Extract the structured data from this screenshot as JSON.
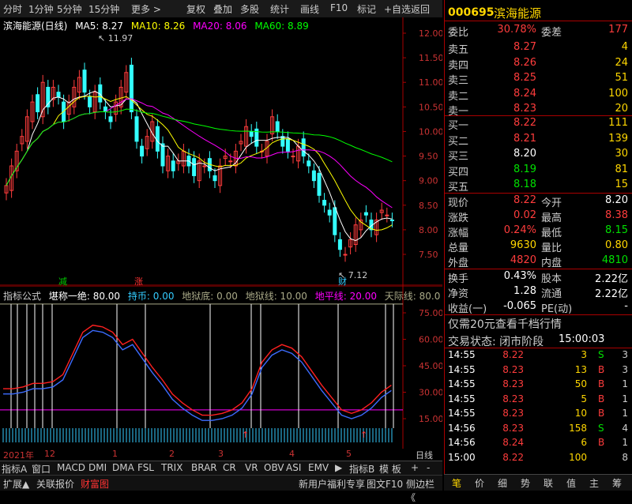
{
  "toolbar": {
    "items": [
      "分时",
      "1分钟",
      "5分钟",
      "15分钟",
      "更多 >",
      "复权",
      "叠加",
      "多股",
      "统计",
      "画线",
      "F10",
      "标记",
      "+自选",
      "返回"
    ]
  },
  "chart_title": {
    "name": "滨海能源(日线)",
    "ma5": "MA5: 8.27",
    "ma10": "MA10: 8.26",
    "ma20": "MA20: 8.06",
    "ma60": "MA60: 8.89"
  },
  "price_axis": [
    "12.00",
    "11.50",
    "11.00",
    "10.50",
    "10.00",
    "9.50",
    "9.00",
    "8.50",
    "8.00",
    "7.50"
  ],
  "annotations": {
    "high": "11.97",
    "low": "7.12",
    "jian": "减",
    "zhang": "涨",
    "cai": "财"
  },
  "indicator_title": {
    "name": "指标公式",
    "line1": "堪称一绝: 80.00",
    "line2": "持币: 0.00",
    "line3": "地狱底: 0.00",
    "line4": "地狱线: 10.00",
    "line5": "地平线: 20.00",
    "line6": "天际线: 80.0"
  },
  "indicator_axis": [
    "75.00",
    "60.00",
    "45.00",
    "30.00",
    "15.00"
  ],
  "date_axis": [
    "2021年",
    "12",
    "1",
    "2",
    "3",
    "4",
    "5"
  ],
  "date_axis_right": "日线",
  "bottom_tabs": [
    "指标A",
    "窗口",
    "MACD",
    "DMI",
    "DMA",
    "FSL",
    "TRIX",
    "BRAR",
    "CR",
    "VR",
    "OBV",
    "ASI",
    "EMV",
    "▶",
    "指标B",
    "模 板",
    "+",
    "-"
  ],
  "bottom_bar": [
    "扩展▲",
    "关联报价",
    "财富图",
    "新用户福利专享",
    "图文F10",
    "侧边栏《"
  ],
  "stock": {
    "code": "000695",
    "name": "滨海能源"
  },
  "weibi": {
    "label": "委比",
    "value": "30.78%",
    "label2": "委差",
    "value2": "177"
  },
  "sell": [
    {
      "label": "卖五",
      "price": "8.27",
      "vol": "4"
    },
    {
      "label": "卖四",
      "price": "8.26",
      "vol": "24"
    },
    {
      "label": "卖三",
      "price": "8.25",
      "vol": "51"
    },
    {
      "label": "卖二",
      "price": "8.24",
      "vol": "100"
    },
    {
      "label": "卖一",
      "price": "8.23",
      "vol": "20"
    }
  ],
  "buy": [
    {
      "label": "买一",
      "price": "8.22",
      "vol": "111"
    },
    {
      "label": "买二",
      "price": "8.21",
      "vol": "139"
    },
    {
      "label": "买三",
      "price": "8.20",
      "vol": "30"
    },
    {
      "label": "买四",
      "price": "8.19",
      "vol": "81"
    },
    {
      "label": "买五",
      "price": "8.18",
      "vol": "15"
    }
  ],
  "quote": [
    {
      "l1": "现价",
      "v1": "8.22",
      "l2": "今开",
      "v2": "8.20"
    },
    {
      "l1": "涨跌",
      "v1": "0.02",
      "l2": "最高",
      "v2": "8.38"
    },
    {
      "l1": "涨幅",
      "v1": "0.24%",
      "l2": "最低",
      "v2": "8.15"
    },
    {
      "l1": "总量",
      "v1": "9630",
      "l2": "量比",
      "v2": "0.80"
    },
    {
      "l1": "外盘",
      "v1": "4820",
      "l2": "内盘",
      "v2": "4810"
    }
  ],
  "quote2": [
    {
      "l1": "换手",
      "v1": "0.43%",
      "l2": "股本",
      "v2": "2.22亿"
    },
    {
      "l1": "净资",
      "v1": "1.28",
      "l2": "流通",
      "v2": "2.22亿"
    },
    {
      "l1": "收益(一)",
      "v1": "-0.065",
      "l2": "PE(动)",
      "v2": "-"
    }
  ],
  "promo": "仅需20元查看千档行情",
  "trade_status": {
    "label": "交易状态: 闭市阶段",
    "time": "15:00:03"
  },
  "ticks": [
    {
      "t": "14:55",
      "p": "8.22",
      "v": "3",
      "s": "S",
      "n": "3"
    },
    {
      "t": "14:55",
      "p": "8.23",
      "v": "13",
      "s": "B",
      "n": "3"
    },
    {
      "t": "14:55",
      "p": "8.23",
      "v": "50",
      "s": "B",
      "n": "1"
    },
    {
      "t": "14:55",
      "p": "8.23",
      "v": "5",
      "s": "B",
      "n": "1"
    },
    {
      "t": "14:55",
      "p": "8.23",
      "v": "10",
      "s": "B",
      "n": "1"
    },
    {
      "t": "14:56",
      "p": "8.23",
      "v": "158",
      "s": "S",
      "n": "4"
    },
    {
      "t": "14:56",
      "p": "8.24",
      "v": "6",
      "s": "B",
      "n": "1"
    },
    {
      "t": "15:00",
      "p": "8.22",
      "v": "100",
      "s": "",
      "n": "8"
    }
  ],
  "right_tabs": [
    "笔",
    "价",
    "细",
    "势",
    "联",
    "值",
    "主",
    "筹"
  ],
  "colors": {
    "up": "#ff3c3c",
    "down": "#00e000",
    "ma5": "#ffffff",
    "ma10": "#ffff00",
    "ma20": "#ff00ff",
    "ma60": "#00ff00"
  }
}
